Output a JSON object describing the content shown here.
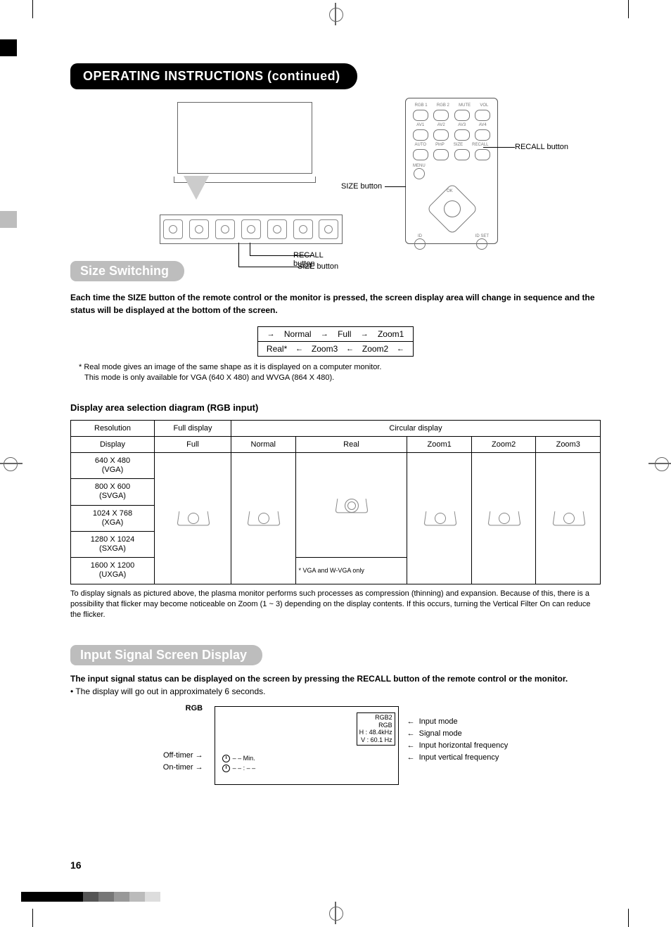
{
  "title": "OPERATING INSTRUCTIONS (continued)",
  "monitor_labels": {
    "recall": "RECALL button",
    "size": "SIZE button"
  },
  "remote_labels": {
    "recall": "RECALL button",
    "size": "SIZE button",
    "buttons_row1": [
      "RGB 1",
      "RGB 2",
      "MUTE",
      "VOL"
    ],
    "buttons_row2": [
      "AV1",
      "AV2",
      "AV3",
      "AV4"
    ],
    "buttons_row3": [
      "AUTO",
      "PinP",
      "SIZE",
      "RECALL"
    ],
    "menu": "MENU",
    "ok": "OK",
    "id": "ID",
    "idset": "ID SET"
  },
  "section_size": "Size Switching",
  "size_intro": "Each time the SIZE button of the remote control or the monitor is pressed, the screen display area will change in sequence and the status will be displayed at the bottom of the screen.",
  "cycle": {
    "top": [
      "Normal",
      "Full",
      "Zoom1"
    ],
    "bottom": [
      "Real*",
      "Zoom3",
      "Zoom2"
    ]
  },
  "cycle_note1": "* Real mode gives an image of the same shape as it is displayed on a computer monitor.",
  "cycle_note2": "This mode is only available for VGA (640 X 480) and WVGA (864 X 480).",
  "subhead_table": "Display area selection diagram (RGB input)",
  "table": {
    "header_row1": [
      "Resolution",
      "Full display",
      "Circular display"
    ],
    "header_row2": [
      "Display",
      "Full",
      "Normal",
      "Real",
      "Zoom1",
      "Zoom2",
      "Zoom3"
    ],
    "resolutions": [
      "640 X 480\n(VGA)",
      "800 X 600\n(SVGA)",
      "1024 X 768\n(XGA)",
      "1280 X 1024\n(SXGA)",
      "1600 X 1200\n(UXGA)"
    ],
    "real_note": "* VGA and W-VGA only"
  },
  "table_footnote": "To display signals as pictured above, the plasma monitor performs such processes as compression (thinning) and expansion. Because of this, there is a possibility that flicker may become noticeable on Zoom (1 ~ 3) depending on the display contents. If this occurs, turning the Vertical Filter On          can reduce the flicker.",
  "section_input": "Input Signal Screen Display",
  "input_intro": "The input signal status can be displayed on the screen by pressing the RECALL button of the remote control or the monitor.",
  "input_bullet": "The display will go out in approximately 6 seconds.",
  "signal_box": {
    "top_label": "RGB",
    "line1": "RGB2",
    "line2": "RGB",
    "line3": "H :   48.4kHz",
    "line4": "V :   60.1 Hz",
    "timer1_label": "– – Min.",
    "timer2_label": "– – : – –"
  },
  "signal_callouts_right": [
    "Input mode",
    "Signal mode",
    "Input horizontal frequency",
    "Input vertical frequency"
  ],
  "signal_callouts_left": [
    "Off-timer",
    "On-timer"
  ],
  "page_number": "16"
}
